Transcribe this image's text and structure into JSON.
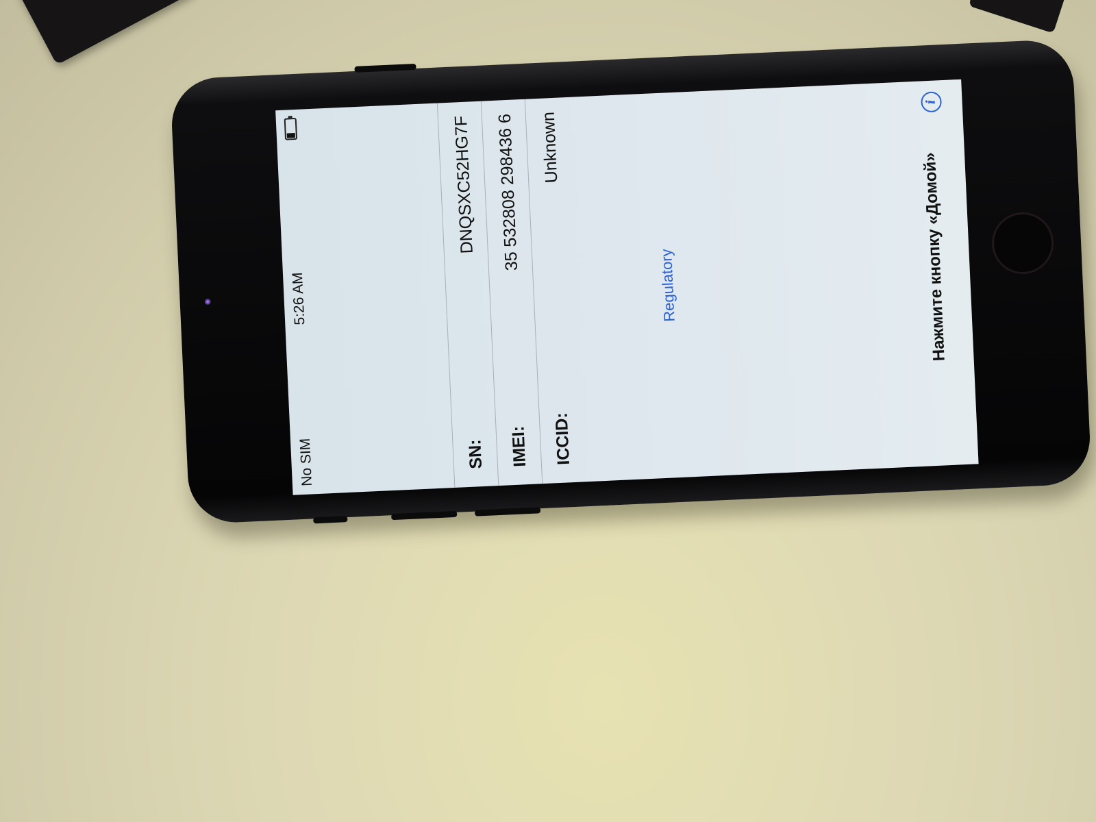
{
  "status_bar": {
    "carrier": "No SIM",
    "time": "5:26 AM",
    "battery_level": 0.25
  },
  "device_info": {
    "rows": [
      {
        "label": "SN:",
        "value": "DNQSXC52HG7F"
      },
      {
        "label": "IMEI:",
        "value": "35 532808 298436 6"
      },
      {
        "label": "ICCID:",
        "value": "Unknown"
      }
    ]
  },
  "regulatory_link": "Regulatory",
  "home_hint": "Нажмите кнопку «Домой»",
  "icons": {
    "info": "info-icon",
    "info_glyph": "i",
    "battery": "battery-icon"
  },
  "colors": {
    "screen_bg": "#dfe8ee",
    "link": "#2a62d4",
    "phone_body": "#0e0e10",
    "table_surface": "#ddd8b4"
  }
}
